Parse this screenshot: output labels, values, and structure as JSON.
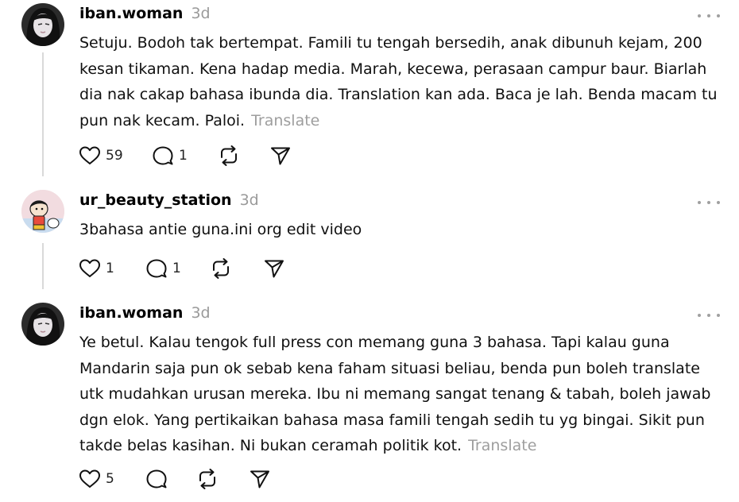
{
  "comments": [
    {
      "username": "iban.woman",
      "time": "3d",
      "text": "Setuju. Bodoh tak bertempat. Famili tu tengah bersedih, anak dibunuh kejam, 200 kesan tikaman. Kena hadap media. Marah, kecewa, perasaan campur baur. Biarlah dia nak cakap bahasa ibunda dia. Translation kan ada. Baca je lah. Benda macam tu pun nak kecam. Paloi.",
      "translate_label": "Translate",
      "likes": "59",
      "replies": "1"
    },
    {
      "username": "ur_beauty_station",
      "time": "3d",
      "text": "3bahasa antie guna.ini org edit video",
      "likes": "1",
      "replies": "1"
    },
    {
      "username": "iban.woman",
      "time": "3d",
      "text": "Ye betul. Kalau tengok full press con memang guna 3 bahasa. Tapi kalau guna Mandarin saja pun ok sebab kena faham situasi beliau, benda pun boleh translate utk mudahkan urusan mereka. Ibu ni memang sangat tenang & tabah, boleh jawab dgn elok. Yang pertikaikan bahasa masa famili tengah sedih tu yg bingai. Sikit pun takde belas kasihan. Ni bukan ceramah politik kot.",
      "translate_label": "Translate",
      "likes": "5"
    }
  ],
  "icons": {
    "like": "heart-icon",
    "reply": "comment-bubble-icon",
    "repost": "repost-icon",
    "share": "send-icon",
    "more": "more-options-icon"
  },
  "colors": {
    "text": "#101010",
    "muted": "#9a9a9a",
    "thread_line": "#d9d9d9"
  }
}
